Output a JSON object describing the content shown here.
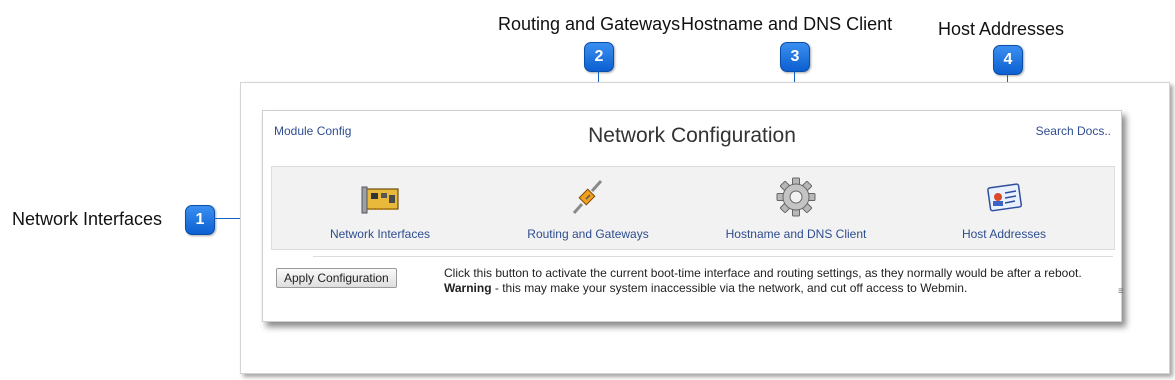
{
  "callouts": [
    {
      "number": "1",
      "label": "Network Interfaces"
    },
    {
      "number": "2",
      "label": "Routing and Gateways"
    },
    {
      "number": "3",
      "label": "Hostname and DNS Client"
    },
    {
      "number": "4",
      "label": "Host Addresses"
    }
  ],
  "header": {
    "module_config": "Module Config",
    "title": "Network Configuration",
    "search_docs": "Search Docs.."
  },
  "icons": [
    {
      "label": "Network Interfaces",
      "icon": "network-card-icon"
    },
    {
      "label": "Routing and Gateways",
      "icon": "cable-connector-icon"
    },
    {
      "label": "Hostname and DNS Client",
      "icon": "gear-icon"
    },
    {
      "label": "Host Addresses",
      "icon": "address-card-icon"
    }
  ],
  "apply": {
    "button_label": "Apply Configuration",
    "description": "Click this button to activate the current boot-time interface and routing settings, as they normally would be after a reboot.",
    "warning_bold": "Warning",
    "warning_text": " - this may make your system inaccessible via the network, and cut off access to Webmin."
  },
  "colors": {
    "link": "#2e4d8f",
    "badge": "#0b5fd1"
  }
}
